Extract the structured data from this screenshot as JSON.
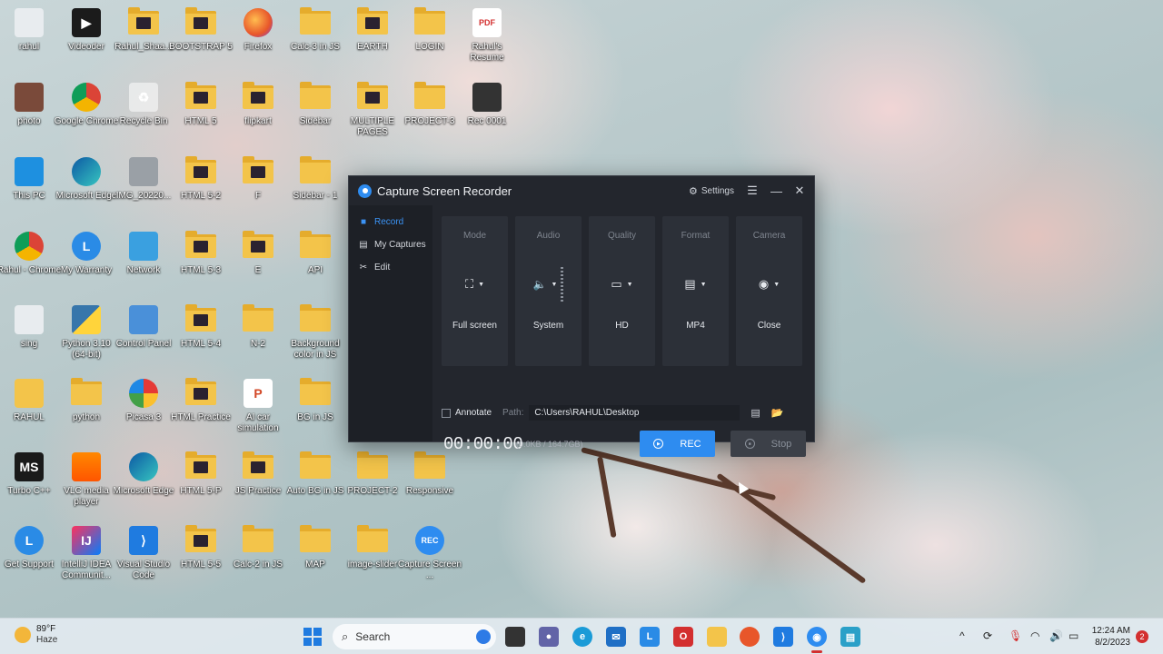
{
  "desktop": {
    "icons": [
      {
        "label": "rahul",
        "col": 0,
        "row": 0,
        "kind": "file"
      },
      {
        "label": "photo",
        "col": 0,
        "row": 1,
        "kind": "photo"
      },
      {
        "label": "This PC",
        "col": 0,
        "row": 2,
        "kind": "pc"
      },
      {
        "label": "Rahul - Chrome",
        "col": 0,
        "row": 3,
        "kind": "chrome"
      },
      {
        "label": "sing",
        "col": 0,
        "row": 4,
        "kind": "file"
      },
      {
        "label": "RAHUL",
        "col": 0,
        "row": 5,
        "kind": "user-folder"
      },
      {
        "label": "Turbo C++",
        "col": 0,
        "row": 6,
        "kind": "turbo"
      },
      {
        "label": "Get Support",
        "col": 0,
        "row": 7,
        "kind": "support"
      },
      {
        "label": "Videoder",
        "col": 1,
        "row": 0,
        "kind": "videoder"
      },
      {
        "label": "Google Chrome",
        "col": 1,
        "row": 1,
        "kind": "chrome"
      },
      {
        "label": "Microsoft Edge",
        "col": 1,
        "row": 2,
        "kind": "edge"
      },
      {
        "label": "My Warranty",
        "col": 1,
        "row": 3,
        "kind": "warranty"
      },
      {
        "label": "Python 3.10 (64-bit)",
        "col": 1,
        "row": 4,
        "kind": "python"
      },
      {
        "label": "python",
        "col": 1,
        "row": 5,
        "kind": "folder-plain"
      },
      {
        "label": "VLC media player",
        "col": 1,
        "row": 6,
        "kind": "vlc"
      },
      {
        "label": "IntelliJ IDEA Communit...",
        "col": 1,
        "row": 7,
        "kind": "intellij"
      },
      {
        "label": "Rahul_Shaa...",
        "col": 2,
        "row": 0,
        "kind": "folder"
      },
      {
        "label": "Recycle Bin",
        "col": 2,
        "row": 1,
        "kind": "recycle"
      },
      {
        "label": "IMG_20220...",
        "col": 2,
        "row": 2,
        "kind": "image"
      },
      {
        "label": "Network",
        "col": 2,
        "row": 3,
        "kind": "network"
      },
      {
        "label": "Control Panel",
        "col": 2,
        "row": 4,
        "kind": "control"
      },
      {
        "label": "Picasa 3",
        "col": 2,
        "row": 5,
        "kind": "picasa"
      },
      {
        "label": "Microsoft Edge",
        "col": 2,
        "row": 6,
        "kind": "edge"
      },
      {
        "label": "Visual Studio Code",
        "col": 2,
        "row": 7,
        "kind": "vscode"
      },
      {
        "label": "BOOTSTRAP 5",
        "col": 3,
        "row": 0,
        "kind": "folder"
      },
      {
        "label": "HTML 5",
        "col": 3,
        "row": 1,
        "kind": "folder"
      },
      {
        "label": "HTML 5-2",
        "col": 3,
        "row": 2,
        "kind": "folder"
      },
      {
        "label": "HTML 5-3",
        "col": 3,
        "row": 3,
        "kind": "folder"
      },
      {
        "label": "HTML 5-4",
        "col": 3,
        "row": 4,
        "kind": "folder"
      },
      {
        "label": "HTML Practice",
        "col": 3,
        "row": 5,
        "kind": "folder"
      },
      {
        "label": "HTML 5-P",
        "col": 3,
        "row": 6,
        "kind": "folder"
      },
      {
        "label": "HTML 5-5",
        "col": 3,
        "row": 7,
        "kind": "folder"
      },
      {
        "label": "Firefox",
        "col": 4,
        "row": 0,
        "kind": "firefox"
      },
      {
        "label": "flipkart",
        "col": 4,
        "row": 1,
        "kind": "folder"
      },
      {
        "label": "F",
        "col": 4,
        "row": 2,
        "kind": "folder"
      },
      {
        "label": "E",
        "col": 4,
        "row": 3,
        "kind": "folder"
      },
      {
        "label": "N-2",
        "col": 4,
        "row": 4,
        "kind": "folder-plain"
      },
      {
        "label": "AI car simulation",
        "col": 4,
        "row": 5,
        "kind": "ppt"
      },
      {
        "label": "JS Practice",
        "col": 4,
        "row": 6,
        "kind": "folder"
      },
      {
        "label": "Calc-2 in JS",
        "col": 4,
        "row": 7,
        "kind": "folder-plain"
      },
      {
        "label": "Calc-3 in JS",
        "col": 5,
        "row": 0,
        "kind": "folder-plain"
      },
      {
        "label": "Sidebar",
        "col": 5,
        "row": 1,
        "kind": "folder-plain"
      },
      {
        "label": "Sidebar - 1",
        "col": 5,
        "row": 2,
        "kind": "folder-plain"
      },
      {
        "label": "API",
        "col": 5,
        "row": 3,
        "kind": "folder-plain"
      },
      {
        "label": "Background color in JS",
        "col": 5,
        "row": 4,
        "kind": "folder-plain"
      },
      {
        "label": "BG in JS",
        "col": 5,
        "row": 5,
        "kind": "folder-plain"
      },
      {
        "label": "Auto BG in JS",
        "col": 5,
        "row": 6,
        "kind": "folder-plain"
      },
      {
        "label": "MAP",
        "col": 5,
        "row": 7,
        "kind": "folder-plain"
      },
      {
        "label": "EARTH",
        "col": 6,
        "row": 0,
        "kind": "folder"
      },
      {
        "label": "MULTIPLE PAGES",
        "col": 6,
        "row": 1,
        "kind": "folder"
      },
      {
        "label": "PROJECT-2",
        "col": 6,
        "row": 6,
        "kind": "folder-plain"
      },
      {
        "label": "image-slider",
        "col": 6,
        "row": 7,
        "kind": "folder-plain"
      },
      {
        "label": "LOGIN",
        "col": 7,
        "row": 0,
        "kind": "folder-plain"
      },
      {
        "label": "PROJECT-3",
        "col": 7,
        "row": 1,
        "kind": "folder-plain"
      },
      {
        "label": "Responsive",
        "col": 7,
        "row": 6,
        "kind": "folder-plain"
      },
      {
        "label": "Capture Screen ...",
        "col": 7,
        "row": 7,
        "kind": "capture"
      },
      {
        "label": "Rahul's Resume",
        "col": 8,
        "row": 0,
        "kind": "pdf"
      },
      {
        "label": "Rec 0001",
        "col": 8,
        "row": 1,
        "kind": "video"
      }
    ]
  },
  "app": {
    "title": "Capture Screen Recorder",
    "settings_label": "Settings",
    "sidebar": [
      {
        "label": "Record",
        "icon": "camera-icon",
        "active": true
      },
      {
        "label": "My Captures",
        "icon": "captures-icon",
        "active": false
      },
      {
        "label": "Edit",
        "icon": "edit-icon",
        "active": false
      }
    ],
    "cards": [
      {
        "head": "Mode",
        "value": "Full screen",
        "icon": "⛶",
        "icon_name": "fullscreen-icon"
      },
      {
        "head": "Audio",
        "value": "System",
        "icon": "🔈",
        "icon_name": "speaker-icon"
      },
      {
        "head": "Quality",
        "value": "HD",
        "icon": "▭",
        "icon_name": "monitor-icon"
      },
      {
        "head": "Format",
        "value": "MP4",
        "icon": "▤",
        "icon_name": "file-icon"
      },
      {
        "head": "Camera",
        "value": "Close",
        "icon": "◉",
        "icon_name": "webcam-icon"
      }
    ],
    "annotate_label": "Annotate",
    "path_label": "Path:",
    "path_value": "C:\\Users\\RAHUL\\Desktop",
    "timer": "00:00:00",
    "size": "(0.0KB / 164.7GB)",
    "rec_label": "REC",
    "stop_label": "Stop",
    "accent": "#2e8cf0"
  },
  "taskbar": {
    "weather_temp": "89°F",
    "weather_desc": "Haze",
    "search_placeholder": "Search",
    "time": "12:24 AM",
    "date": "8/2/2023",
    "notifications": "2"
  }
}
